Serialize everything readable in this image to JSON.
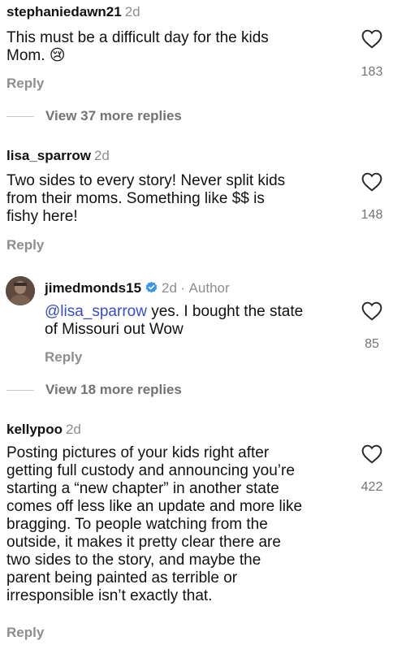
{
  "comments": [
    {
      "username": "stephaniedawn21",
      "time": "2d",
      "text_lines": [
        "This must be a difficult day for the kids",
        "Mom. 😢"
      ],
      "likes": "183",
      "reply_label": "Reply",
      "view_more": "View 37 more replies"
    },
    {
      "username": "lisa_sparrow",
      "time": "2d",
      "text_lines": [
        "Two sides to every story!  Never split kids",
        "from their moms.  Something like $$ is",
        "fishy here!"
      ],
      "likes": "148",
      "reply_label": "Reply"
    },
    {
      "username": "jimedmonds15",
      "time": "2d",
      "separator": "·",
      "author_tag": "Author",
      "mention": "@lisa_sparrow",
      "text_after_mention": " yes.  I bought the state",
      "text_line2": "of Missouri out  Wow",
      "likes": "85",
      "reply_label": "Reply",
      "view_more": "View 18 more replies"
    },
    {
      "username": "kellypoo",
      "time": "2d",
      "text_lines": [
        "Posting pictures of your kids right after",
        "getting full custody and announcing you’re",
        "starting a “new chapter” in another state",
        "comes off less like an update and more like",
        "bragging. To people watching from the",
        "outside, it makes it pretty clear there are",
        "two sides to the story, and maybe the",
        "parent being painted as terrible or",
        "irresponsible isn’t exactly that."
      ],
      "likes": "422",
      "reply_label": "Reply"
    }
  ],
  "colors": {
    "verified": "#3897f0",
    "mention": "#3b4bc7",
    "muted": "#8e8e8e"
  }
}
